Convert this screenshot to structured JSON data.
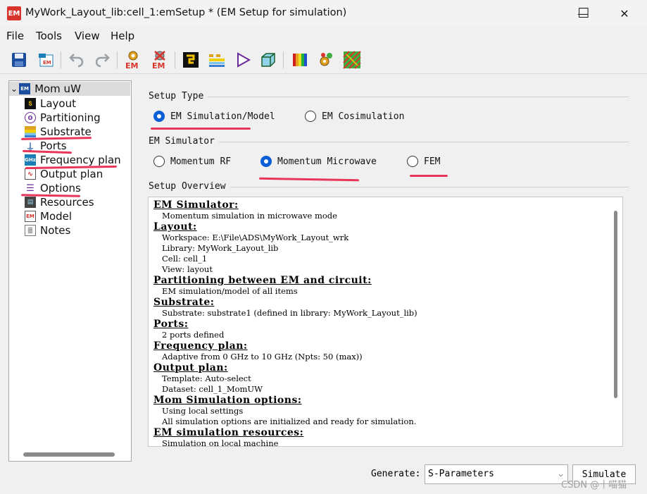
{
  "window": {
    "app_icon_text": "EM",
    "title": "MyWork_Layout_lib:cell_1:emSetup * (EM Setup for simulation)",
    "minimize_glyph": "—",
    "maximize_glyph": "☐",
    "close_glyph": "✕"
  },
  "menu": [
    "File",
    "Tools",
    "View",
    "Help"
  ],
  "toolbar": {
    "icons": [
      "save-icon",
      "open-layout-icon",
      "undo-icon",
      "redo-icon",
      "em-simulate-icon",
      "em-stop-icon",
      "ports-editor-icon",
      "substrate-editor-icon",
      "component-icon",
      "3d-view-icon",
      "visualization-icon",
      "parameters-icon",
      "mesh-icon"
    ],
    "em_label": "EM"
  },
  "tree": {
    "root": "Mom uW",
    "items": [
      {
        "label": "Layout",
        "icon": "layout-icon"
      },
      {
        "label": "Partitioning",
        "icon": "partitioning-icon"
      },
      {
        "label": "Substrate",
        "icon": "substrate-icon"
      },
      {
        "label": "Ports",
        "icon": "ports-icon"
      },
      {
        "label": "Frequency plan",
        "icon": "frequency-plan-icon",
        "icon_text": "GHz"
      },
      {
        "label": "Output plan",
        "icon": "output-plan-icon"
      },
      {
        "label": "Options",
        "icon": "options-icon"
      },
      {
        "label": "Resources",
        "icon": "resources-icon"
      },
      {
        "label": "Model",
        "icon": "model-icon"
      },
      {
        "label": "Notes",
        "icon": "notes-icon"
      }
    ]
  },
  "setup_type": {
    "label": "Setup Type",
    "options": [
      {
        "label": "EM Simulation/Model",
        "checked": true
      },
      {
        "label": "EM Cosimulation",
        "checked": false
      }
    ]
  },
  "em_simulator": {
    "label": "EM Simulator",
    "options": [
      {
        "label": "Momentum RF",
        "checked": false
      },
      {
        "label": "Momentum Microwave",
        "checked": true
      },
      {
        "label": "FEM",
        "checked": false
      }
    ]
  },
  "overview": {
    "label": "Setup Overview",
    "sections": [
      {
        "head": "EM Simulator:",
        "lines": [
          "Momentum simulation in microwave mode"
        ]
      },
      {
        "head": "Layout:",
        "lines": [
          "Workspace: E:\\File\\ADS\\MyWork_Layout_wrk",
          "Library: MyWork_Layout_lib",
          "Cell: cell_1",
          "View: layout"
        ]
      },
      {
        "head": "Partitioning between EM and circuit:",
        "lines": [
          "EM simulation/model of all items"
        ]
      },
      {
        "head": "Substrate:",
        "lines": [
          "Substrate: substrate1 (defined in library: MyWork_Layout_lib)"
        ]
      },
      {
        "head": "Ports:",
        "lines": [
          "2 ports defined"
        ]
      },
      {
        "head": "Frequency plan:",
        "lines": [
          "Adaptive from 0 GHz to 10 GHz (Npts: 50 (max))"
        ]
      },
      {
        "head": "Output plan:",
        "lines": [
          "Template: Auto-select",
          "Dataset: cell_1_MomUW"
        ]
      },
      {
        "head": "Mom Simulation options:",
        "lines": [
          "Using local settings",
          "All simulation options are initialized and ready for simulation."
        ]
      },
      {
        "head": "EM simulation resources:",
        "lines": [
          "Simulation on local machine"
        ]
      }
    ]
  },
  "footer": {
    "generate_label": "Generate:",
    "generate_value": "S-Parameters",
    "simulate_label": "Simulate",
    "watermark": "CSDN @十喵猫"
  },
  "colors": {
    "accent": "#0a5fd6",
    "annotation_red": "#e8365a",
    "app_icon": "#d9342b"
  }
}
